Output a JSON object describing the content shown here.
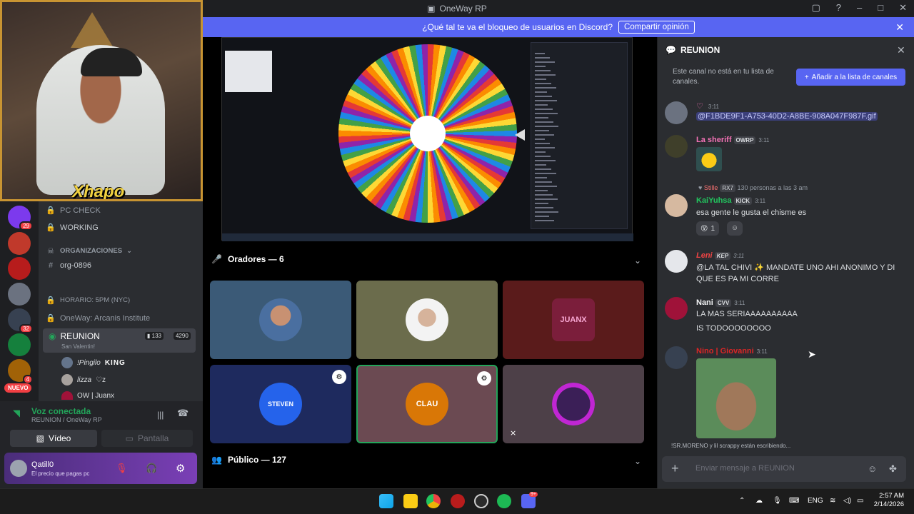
{
  "window": {
    "title": "OneWay RP"
  },
  "notice": {
    "text": "¿Qué tal te va el bloqueo de usuarios en Discord?",
    "button": "Compartir opinión"
  },
  "webcam": {
    "overlay_name": "Xhapo"
  },
  "rail": {
    "badges": [
      "29",
      "32",
      "4"
    ],
    "new_label": "NUEVO"
  },
  "channels": {
    "pc_check": "PC CHECK",
    "working": "WORKING",
    "category": "ORGANIZACIONES",
    "org": "org-0896",
    "horario": "HORARIO: 5PM (NYC)",
    "institute": "OneWay: Arcanis Institute",
    "reunion": "REUNION",
    "reunion_sub": "San Valentin!",
    "reunion_count": "133",
    "reunion_limit": "4290",
    "members": [
      "!Pingilo",
      "lizza",
      "OW | Juanx"
    ],
    "member_tags": [
      "KING",
      "♡z",
      ""
    ]
  },
  "voice": {
    "status": "Voz conectada",
    "location": "REUNION / OneWay RP",
    "video_btn": "Vídeo",
    "screen_btn": "Pantalla"
  },
  "user": {
    "name": "Qatill0",
    "status": "El precio que pagas pc"
  },
  "stage": {
    "speakers_label": "Oradores — 6",
    "public_label": "Público — 127",
    "tiles": [
      "",
      "",
      "JUANX",
      "STEVEN",
      "CLAU",
      ""
    ]
  },
  "chat": {
    "title": "REUNION",
    "note": "Este canal no está en tu lista de canales.",
    "add_button": "Añadir a la lista de canales",
    "messages": [
      {
        "user": "",
        "time": "3:11",
        "text": "@F1BDE9F1-A753-40D2-A8BE-908A047F987F.gif"
      },
      {
        "user": "La sheriff",
        "tag": "OWRP",
        "time": "3:11",
        "text": ""
      },
      {
        "reply": "130 personas a las 3 am",
        "reply_user": "Stille",
        "reply_tag": "RX7"
      },
      {
        "user": "KaiYuhsa",
        "tag": "KICK",
        "time": "3:11",
        "text": "esa gente le gusta el chisme es",
        "reaction": "1"
      },
      {
        "user": "Leni",
        "tag": "KEP",
        "time": "3:11",
        "text": "@LA TAL CHIVI ✨ MANDATE UNO AHI ANONIMO Y DI",
        "text2": "QUE ES PA MI CORRE"
      },
      {
        "user": "Nani",
        "tag": "CVV",
        "time": "3:11",
        "text": "LA MAS SERIAAAAAAAAAA",
        "text2": "IS TODOOOOOOOO"
      },
      {
        "user": "Nino | Giovanni",
        "time": "3:11",
        "text": ""
      }
    ],
    "typing": "!SR.MORENO y lil scrappy están escribiendo...",
    "placeholder": "Enviar mensaje a REUNION"
  },
  "taskbar": {
    "lang": "ENG",
    "time": "2:57 AM",
    "date": "2/14/2026",
    "discord_badge": "9+"
  }
}
